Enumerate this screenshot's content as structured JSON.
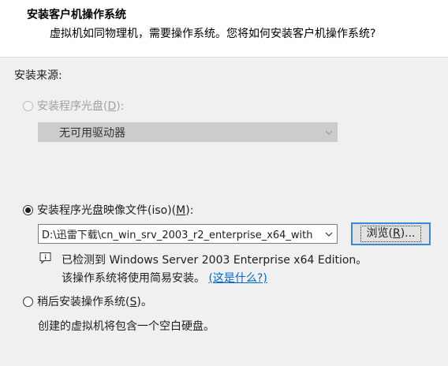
{
  "header": {
    "title": "安装客户机操作系统",
    "subtitle": "虚拟机如同物理机，需要操作系统。您将如何安装客户机操作系统?"
  },
  "source_label": "安装来源:",
  "options": {
    "disc": {
      "label_prefix": "安装程序光盘(",
      "accel": "D",
      "label_suffix": "):",
      "selected": false,
      "enabled": false,
      "dropdown_value": "无可用驱动器"
    },
    "iso": {
      "label_prefix": "安装程序光盘映像文件(iso)(",
      "accel": "M",
      "label_suffix": "):",
      "selected": true,
      "path_value": "D:\\迅雷下载\\cn_win_srv_2003_r2_enterprise_x64_with",
      "browse_prefix": "浏览(",
      "browse_accel": "R",
      "browse_suffix": ")...",
      "detected_text": "已检测到 Windows Server 2003 Enterprise x64 Edition。",
      "easy_install_text": "该操作系统将使用简易安装。",
      "help_link": "(这是什么?)"
    },
    "later": {
      "label_prefix": "稍后安装操作系统(",
      "accel": "S",
      "label_suffix": ")。",
      "selected": false,
      "note": "创建的虚拟机将包含一个空白硬盘。"
    }
  },
  "icons": {
    "info": "info-icon",
    "chevron": "chevron-down-icon"
  },
  "colors": {
    "accent": "#3c87d6",
    "link": "#0066cc",
    "disabled_text": "#a0a0a0"
  }
}
